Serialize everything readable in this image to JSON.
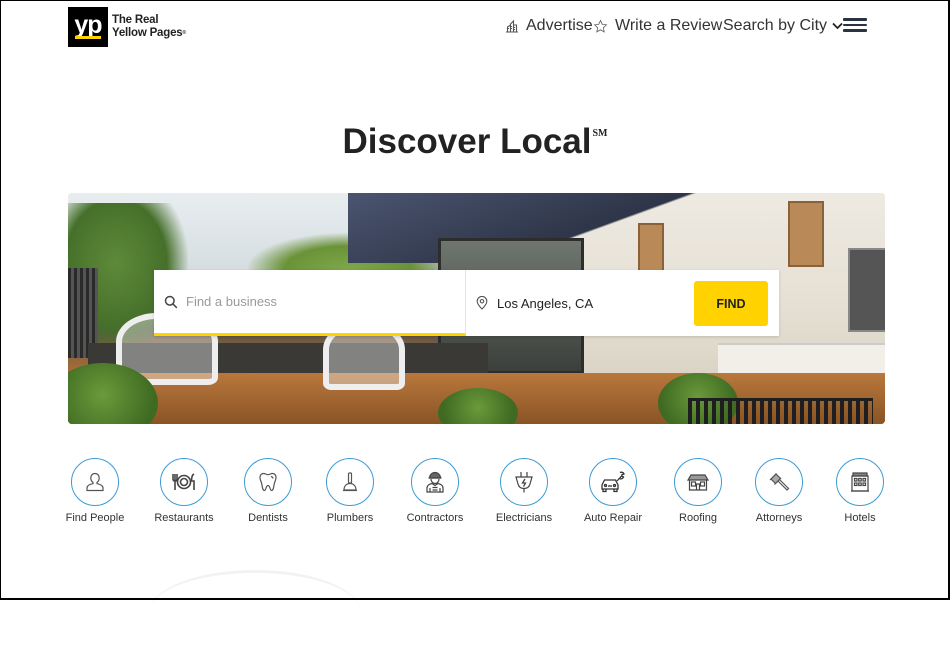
{
  "header": {
    "logo": {
      "mark": "yp",
      "line1": "The Real",
      "line2": "Yellow Pages",
      "trademark": "®"
    },
    "nav": {
      "advertise": {
        "label": "Advertise",
        "icon": "chart-building-icon"
      },
      "write_review": {
        "label": "Write a Review",
        "icon": "star-outline-icon"
      },
      "search_by_city": {
        "label": "Search by City",
        "icon": "chevron-down-icon"
      },
      "menu": {
        "icon": "hamburger-menu-icon"
      }
    }
  },
  "hero": {
    "title": "Discover Local",
    "title_mark": "SM"
  },
  "search": {
    "what": {
      "placeholder": "Find a business",
      "value": "",
      "icon": "search-icon"
    },
    "where": {
      "value": "Los Angeles, CA",
      "icon": "location-pin-icon"
    },
    "find_label": "FIND"
  },
  "categories": [
    {
      "label": "Find People",
      "icon": "person-icon"
    },
    {
      "label": "Restaurants",
      "icon": "plate-fork-knife-icon"
    },
    {
      "label": "Dentists",
      "icon": "tooth-icon"
    },
    {
      "label": "Plumbers",
      "icon": "plunger-icon"
    },
    {
      "label": "Contractors",
      "icon": "worker-hardhat-icon"
    },
    {
      "label": "Electricians",
      "icon": "electric-plug-icon"
    },
    {
      "label": "Auto Repair",
      "icon": "car-wrench-icon"
    },
    {
      "label": "Roofing",
      "icon": "house-roof-icon"
    },
    {
      "label": "Attorneys",
      "icon": "gavel-icon"
    },
    {
      "label": "Hotels",
      "icon": "hotel-building-icon"
    }
  ],
  "colors": {
    "brand_yellow": "#ffd200",
    "brand_black": "#000000",
    "category_ring": "#3d9bd4",
    "text": "#333333"
  }
}
